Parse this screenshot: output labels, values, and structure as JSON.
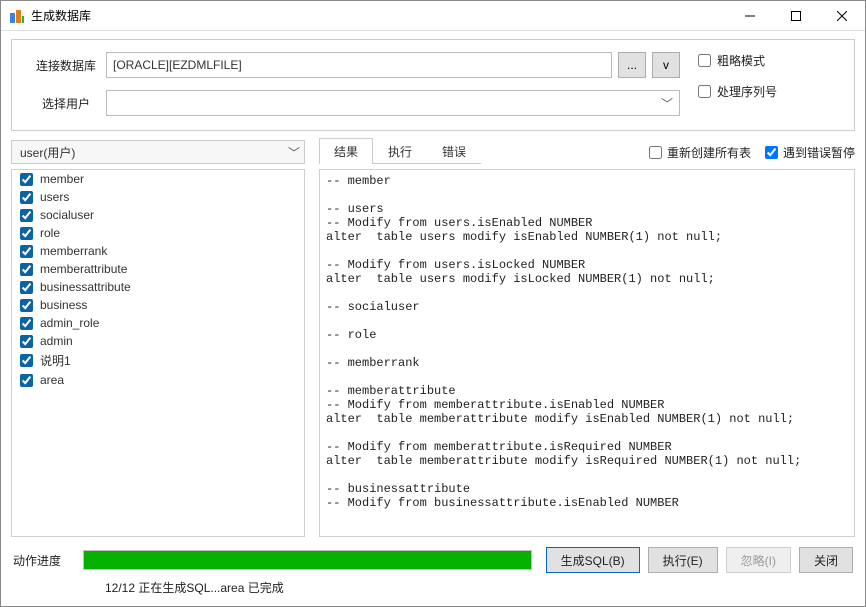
{
  "window": {
    "title": "生成数据库"
  },
  "config": {
    "db_label": "连接数据库",
    "db_value": "[ORACLE][EZDMLFILE]",
    "browse_label": "...",
    "dropdown_label": "v",
    "user_label": "选择用户",
    "user_value": "",
    "rough_mode_label": "粗略模式",
    "rough_mode_checked": false,
    "process_seq_label": "处理序列号",
    "process_seq_checked": false
  },
  "entity_dropdown": {
    "label": "user(用户)"
  },
  "tabs": {
    "items": [
      "结果",
      "执行",
      "错误"
    ],
    "active": 0
  },
  "options": {
    "recreate_label": "重新创建所有表",
    "recreate_checked": false,
    "pause_label": "遇到错误暂停",
    "pause_checked": true
  },
  "tables": [
    "member",
    "users",
    "socialuser",
    "role",
    "memberrank",
    "memberattribute",
    "businessattribute",
    "business",
    "admin_role",
    "admin",
    "说明1",
    "area"
  ],
  "output_text": "-- member\n\n-- users\n-- Modify from users.isEnabled NUMBER\nalter  table users modify isEnabled NUMBER(1) not null;\n\n-- Modify from users.isLocked NUMBER\nalter  table users modify isLocked NUMBER(1) not null;\n\n-- socialuser\n\n-- role\n\n-- memberrank\n\n-- memberattribute\n-- Modify from memberattribute.isEnabled NUMBER\nalter  table memberattribute modify isEnabled NUMBER(1) not null;\n\n-- Modify from memberattribute.isRequired NUMBER\nalter  table memberattribute modify isRequired NUMBER(1) not null;\n\n-- businessattribute\n-- Modify from businessattribute.isEnabled NUMBER",
  "progress": {
    "label": "动作进度",
    "percent": 100,
    "status": "12/12 正在生成SQL...area 已完成"
  },
  "buttons": {
    "gensql": "生成SQL(B)",
    "execute": "执行(E)",
    "ignore": "忽略(I)",
    "close": "关闭"
  }
}
